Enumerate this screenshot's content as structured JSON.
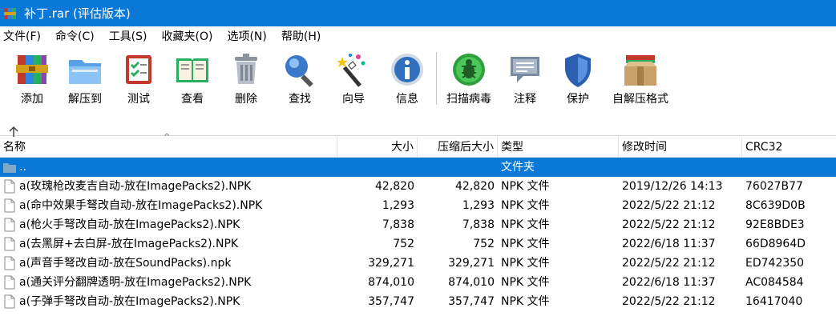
{
  "window": {
    "title": "补丁.rar (评估版本)"
  },
  "menu": [
    {
      "label": "文件(F)"
    },
    {
      "label": "命令(C)"
    },
    {
      "label": "工具(S)"
    },
    {
      "label": "收藏夹(O)"
    },
    {
      "label": "选项(N)"
    },
    {
      "label": "帮助(H)"
    }
  ],
  "toolbar": [
    {
      "label": "添加",
      "icon": "add-archive-icon"
    },
    {
      "label": "解压到",
      "icon": "extract-to-icon"
    },
    {
      "label": "测试",
      "icon": "test-icon"
    },
    {
      "label": "查看",
      "icon": "view-icon"
    },
    {
      "label": "删除",
      "icon": "delete-icon"
    },
    {
      "label": "查找",
      "icon": "find-icon"
    },
    {
      "label": "向导",
      "icon": "wizard-icon"
    },
    {
      "label": "信息",
      "icon": "info-icon"
    },
    {
      "label": "扫描病毒",
      "icon": "virus-scan-icon"
    },
    {
      "label": "注释",
      "icon": "comment-icon"
    },
    {
      "label": "保护",
      "icon": "protect-icon"
    },
    {
      "label": "自解压格式",
      "icon": "sfx-icon"
    }
  ],
  "columns": {
    "name": "名称",
    "size": "大小",
    "packed": "压缩后大小",
    "type": "类型",
    "modified": "修改时间",
    "crc": "CRC32"
  },
  "parent_row": {
    "name": "..",
    "type": "文件夹"
  },
  "files": [
    {
      "name": "a(玫瑰枪改麦吉自动-放在ImagePacks2).NPK",
      "size": "42,820",
      "packed": "42,820",
      "type": "NPK 文件",
      "modified": "2019/12/26 14:13",
      "crc": "76027B77"
    },
    {
      "name": "a(命中效果手弩改自动-放在ImagePacks2).NPK",
      "size": "1,293",
      "packed": "1,293",
      "type": "NPK 文件",
      "modified": "2022/5/22 21:12",
      "crc": "8C639D0B"
    },
    {
      "name": "a(枪火手弩改自动-放在ImagePacks2).NPK",
      "size": "7,838",
      "packed": "7,838",
      "type": "NPK 文件",
      "modified": "2022/5/22 21:12",
      "crc": "92E8BDE3"
    },
    {
      "name": "a(去黑屏+去白屏-放在ImagePacks2).NPK",
      "size": "752",
      "packed": "752",
      "type": "NPK 文件",
      "modified": "2022/6/18 11:37",
      "crc": "66D8964D"
    },
    {
      "name": "a(声音手弩改自动-放在SoundPacks).npk",
      "size": "329,271",
      "packed": "329,271",
      "type": "NPK 文件",
      "modified": "2022/5/22 21:12",
      "crc": "ED742350"
    },
    {
      "name": "a(通关评分翻牌透明-放在ImagePacks2).NPK",
      "size": "874,010",
      "packed": "874,010",
      "type": "NPK 文件",
      "modified": "2022/6/18 11:37",
      "crc": "AC084584"
    },
    {
      "name": "a(子弹手弩改自动-放在ImagePacks2).NPK",
      "size": "357,747",
      "packed": "357,747",
      "type": "NPK 文件",
      "modified": "2022/5/22 21:12",
      "crc": "16417040"
    }
  ]
}
